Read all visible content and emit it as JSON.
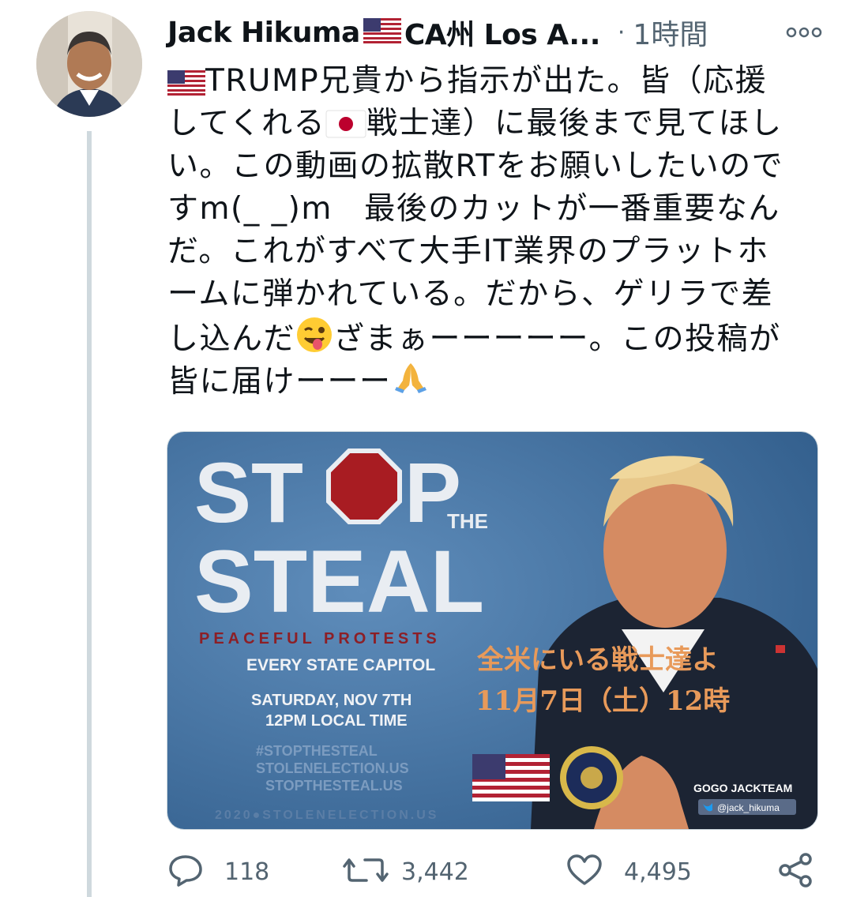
{
  "tweet": {
    "author_name": "Jack Hikuma",
    "author_location": "CA州 Los A...",
    "time_ago": "1時間",
    "text_lines": [
      [
        "",
        "TRUMP兄貴から指示が出た。皆（応援"
      ],
      [
        "してくれる",
        "戦士達）に最後まで見てほし"
      ],
      [
        "い。この動画の拡散RTをお願いしたいので"
      ],
      [
        "すm(_ _)m　最後のカットが一番重要なん"
      ],
      [
        "だ。これがすべて大手IT業界のプラットホ"
      ],
      [
        "ームに弾かれている。だから、ゲリラで差"
      ],
      [
        "し込んだ",
        "ざまぁーーーーー。この投稿が"
      ],
      [
        "皆に届けーーー"
      ]
    ],
    "icons": {
      "more": "more-horizontal-icon",
      "reply": "reply-icon",
      "retweet": "retweet-icon",
      "like": "heart-icon",
      "share": "share-icon"
    },
    "colors": {
      "muted": "#536471",
      "divider": "#cfd9de",
      "flag_red": "#b22234",
      "japan_red": "#bc002d"
    }
  },
  "media": {
    "stop": "ST",
    "stop_end": "P",
    "the": "THE",
    "steal": "STEAL",
    "peaceful": "PEACEFUL PROTESTS",
    "every_state": "EVERY STATE CAPITOL",
    "date_line": "SATURDAY, NOV 7TH",
    "time_line": "12PM LOCAL TIME",
    "hashtag": "#STOPTHESTEAL",
    "url1": "STOLENELECTION.US",
    "url2": "STOPTHESTEAL.US",
    "footer_url": "2020●STOLENELECTION.US",
    "jp_line1": "全米にいる戦士達よ",
    "jp_line2": "11月7日（土）12時",
    "team": "GOGO JACKTEAM",
    "handle": "@jack_hikuma",
    "colors": {
      "bg": "#3e6fa0",
      "stop_sign": "#a81c22",
      "jp_text": "#e89a5a",
      "peaceful": "#8c1f26"
    }
  },
  "actions": {
    "replies": "118",
    "retweets": "3,442",
    "likes": "4,495"
  }
}
